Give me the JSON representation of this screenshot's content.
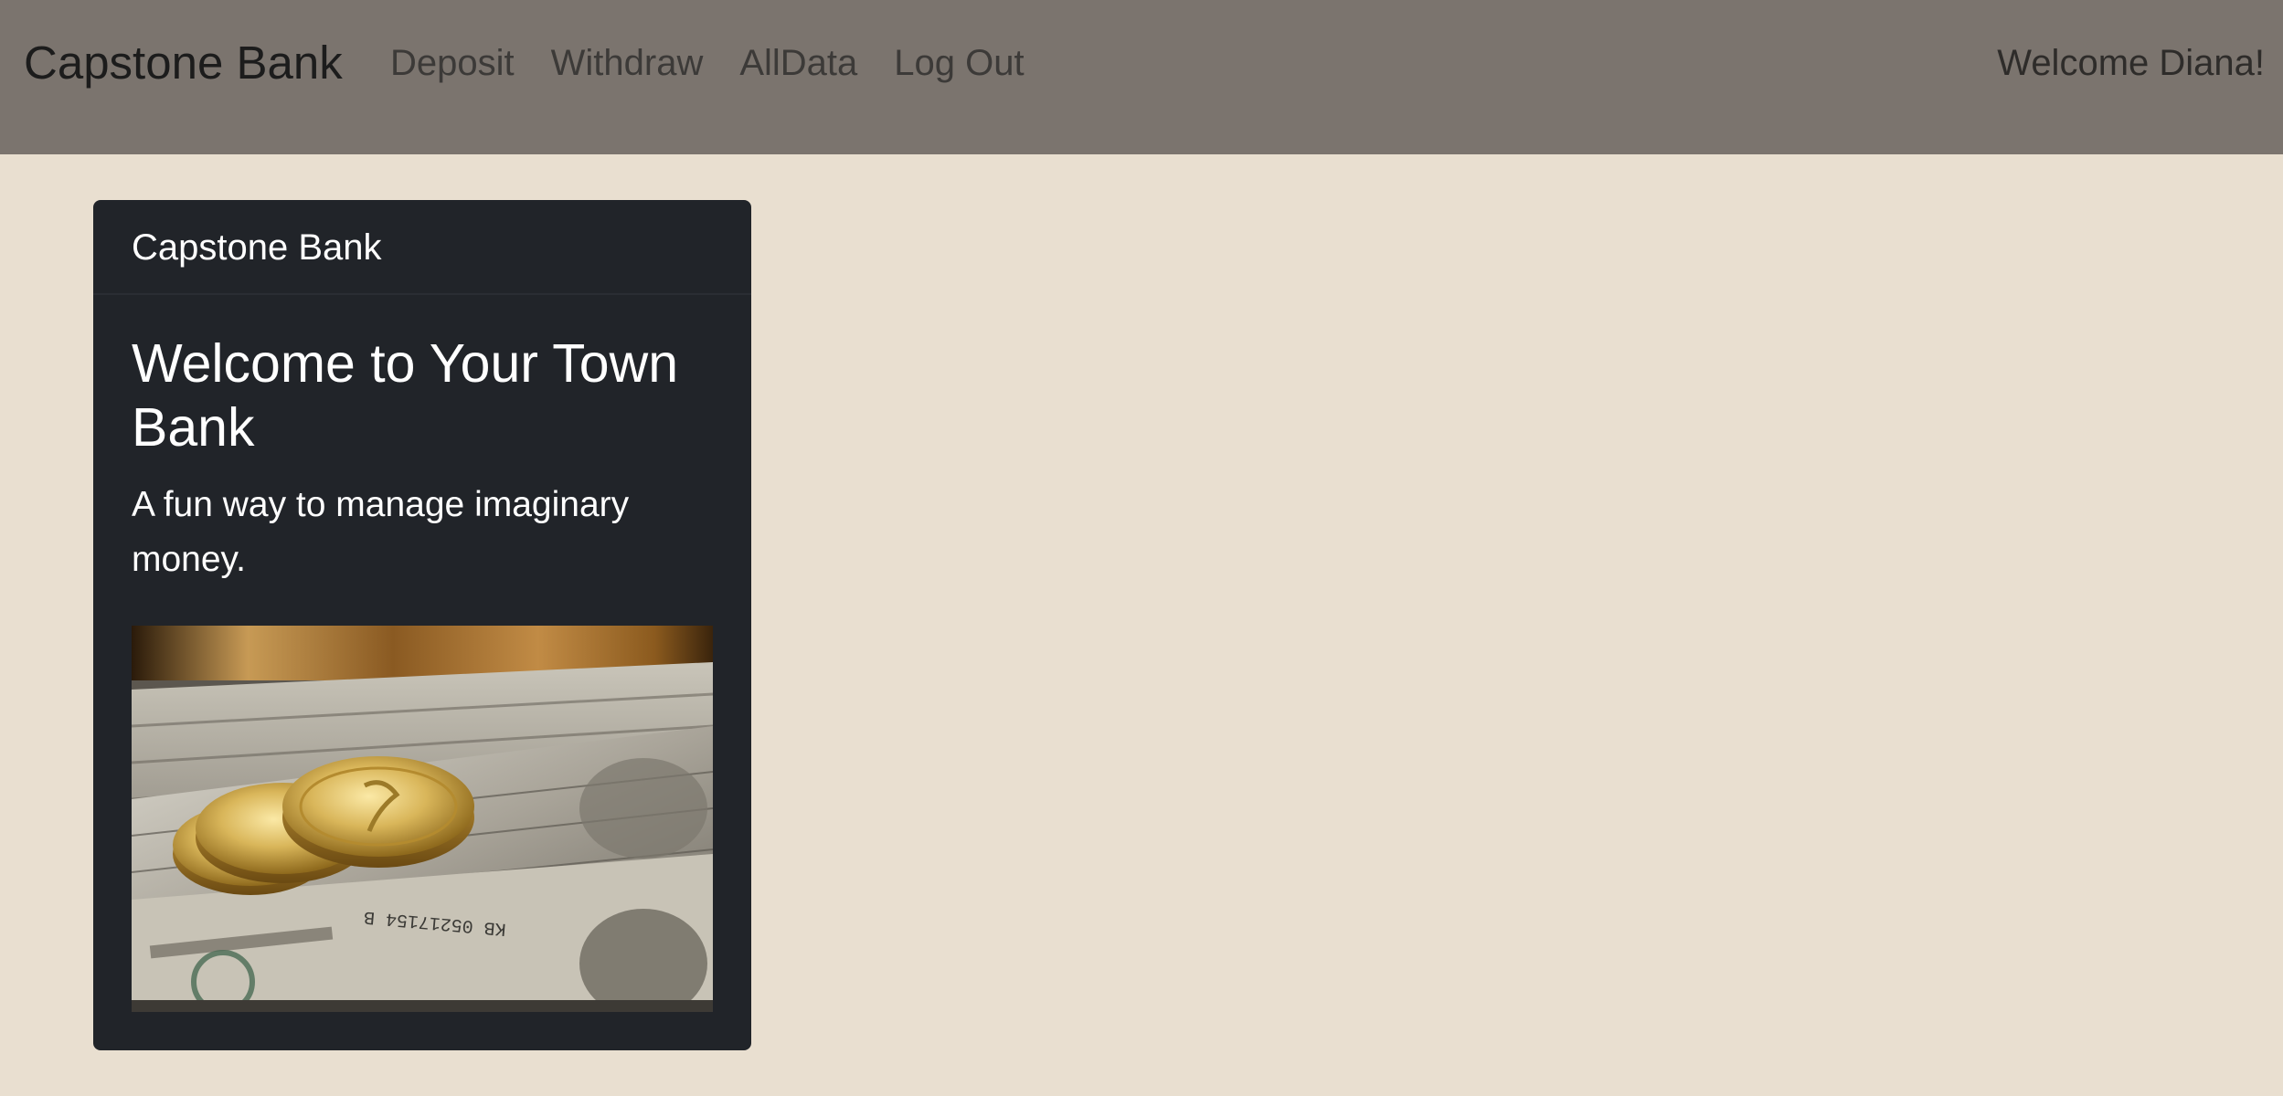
{
  "navbar": {
    "brand": "Capstone Bank",
    "links": [
      {
        "label": "Deposit"
      },
      {
        "label": "Withdraw"
      },
      {
        "label": "AllData"
      },
      {
        "label": "Log Out"
      }
    ],
    "welcome": "Welcome Diana!"
  },
  "card": {
    "header": "Capstone Bank",
    "title": "Welcome to Your Town Bank",
    "text": "A fun way to manage imaginary money.",
    "image": {
      "subject": "gold coins on stacked dollar bills",
      "serial_text": "KB 05217154 B"
    }
  },
  "colors": {
    "page_background": "#e9dfd0",
    "navbar_background": "#7b746e",
    "card_background": "#212429"
  }
}
